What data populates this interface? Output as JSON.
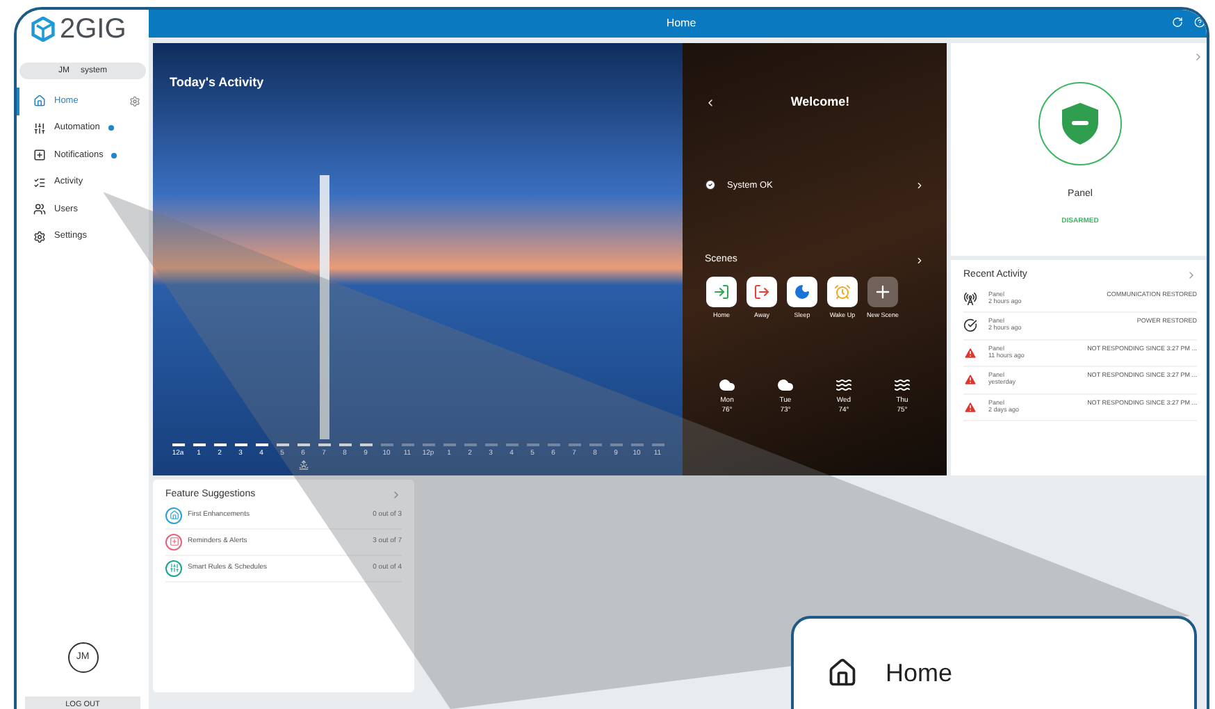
{
  "sidebar": {
    "brand": "2GIG",
    "user": {
      "initials": "JM",
      "name": "system"
    },
    "items": [
      {
        "label": "Home",
        "kind": "home",
        "selected": true,
        "dot": false,
        "gear": true
      },
      {
        "label": "Automation",
        "kind": "sliders",
        "selected": false,
        "dot": true,
        "gear": false
      },
      {
        "label": "Notifications",
        "kind": "notify",
        "selected": false,
        "dot": true,
        "gear": false
      },
      {
        "label": "Activity",
        "kind": "activity",
        "selected": false,
        "dot": false,
        "gear": false
      },
      {
        "label": "Users",
        "kind": "users",
        "selected": false,
        "dot": false,
        "gear": false
      },
      {
        "label": "Settings",
        "kind": "settings",
        "selected": false,
        "dot": false,
        "gear": false
      }
    ],
    "avatar": "JM",
    "logout": "LOG OUT"
  },
  "header": {
    "title": "Home"
  },
  "activity": {
    "title": "Today's Activity",
    "hours": [
      {
        "label": "12a",
        "active": true,
        "selected": false
      },
      {
        "label": "1",
        "active": true,
        "selected": false
      },
      {
        "label": "2",
        "active": true,
        "selected": false
      },
      {
        "label": "3",
        "active": true,
        "selected": false
      },
      {
        "label": "4",
        "active": true,
        "selected": false
      },
      {
        "label": "5",
        "active": true,
        "selected": false
      },
      {
        "label": "6",
        "active": true,
        "selected": false
      },
      {
        "label": "7",
        "active": true,
        "selected": true
      },
      {
        "label": "8",
        "active": true,
        "selected": false
      },
      {
        "label": "9",
        "active": true,
        "selected": false
      },
      {
        "label": "10",
        "active": false,
        "selected": false
      },
      {
        "label": "11",
        "active": false,
        "selected": false
      },
      {
        "label": "12p",
        "active": false,
        "selected": false
      },
      {
        "label": "1",
        "active": false,
        "selected": false
      },
      {
        "label": "2",
        "active": false,
        "selected": false
      },
      {
        "label": "3",
        "active": false,
        "selected": false
      },
      {
        "label": "4",
        "active": false,
        "selected": false
      },
      {
        "label": "5",
        "active": false,
        "selected": false
      },
      {
        "label": "6",
        "active": false,
        "selected": false
      },
      {
        "label": "7",
        "active": false,
        "selected": false
      },
      {
        "label": "8",
        "active": false,
        "selected": false
      },
      {
        "label": "9",
        "active": false,
        "selected": false
      },
      {
        "label": "10",
        "active": false,
        "selected": false
      },
      {
        "label": "11",
        "active": false,
        "selected": false
      }
    ]
  },
  "welcome": {
    "title": "Welcome!",
    "status": "System OK",
    "scenes_title": "Scenes",
    "scenes": [
      {
        "label": "Home",
        "kind": "home"
      },
      {
        "label": "Away",
        "kind": "away"
      },
      {
        "label": "Sleep",
        "kind": "sleep"
      },
      {
        "label": "Wake Up",
        "kind": "wake"
      },
      {
        "label": "New Scene",
        "kind": "new"
      }
    ],
    "weather": [
      {
        "day": "Mon",
        "temp": "76°",
        "kind": "cloud"
      },
      {
        "day": "Tue",
        "temp": "73°",
        "kind": "cloud"
      },
      {
        "day": "Wed",
        "temp": "74°",
        "kind": "wind"
      },
      {
        "day": "Thu",
        "temp": "75°",
        "kind": "wind"
      }
    ]
  },
  "panel": {
    "name": "Panel",
    "status": "DISARMED"
  },
  "recent": {
    "title": "Recent Activity",
    "items": [
      {
        "kind": "signal",
        "device": "Panel",
        "time": "2 hours ago",
        "event": "COMMUNICATION RESTORED"
      },
      {
        "kind": "check",
        "device": "Panel",
        "time": "2 hours ago",
        "event": "POWER RESTORED"
      },
      {
        "kind": "alert",
        "device": "Panel",
        "time": "11 hours ago",
        "event": "NOT RESPONDING SINCE 3:27 PM ..."
      },
      {
        "kind": "alert",
        "device": "Panel",
        "time": "yesterday",
        "event": "NOT RESPONDING SINCE 3:27 PM ..."
      },
      {
        "kind": "alert",
        "device": "Panel",
        "time": "2 days ago",
        "event": "NOT RESPONDING SINCE 3:27 PM ..."
      }
    ]
  },
  "suggestions": {
    "title": "Feature Suggestions",
    "items": [
      {
        "label": "First Enhancements",
        "count": "0 out of 3",
        "color": "#2a9fd8",
        "kind": "home"
      },
      {
        "label": "Reminders & Alerts",
        "count": "3 out of 7",
        "color": "#e8607a",
        "kind": "notify"
      },
      {
        "label": "Smart Rules & Schedules",
        "count": "0 out of 4",
        "color": "#17a398",
        "kind": "sliders"
      }
    ]
  },
  "callout": {
    "label": "Home"
  }
}
